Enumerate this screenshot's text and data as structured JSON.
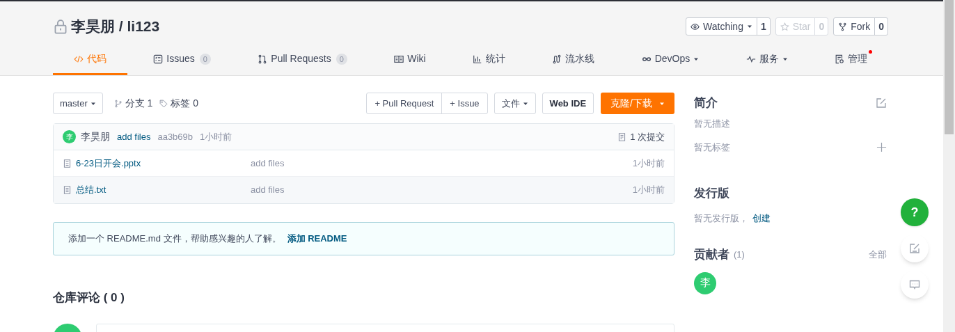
{
  "repo": {
    "title": "李昊朋 / li123",
    "private": true
  },
  "actions": [
    {
      "kind": "watch",
      "label": "Watching",
      "dropdown": true,
      "count": "1",
      "disabled": false
    },
    {
      "kind": "star",
      "label": "Star",
      "dropdown": false,
      "count": "0",
      "disabled": true
    },
    {
      "kind": "fork",
      "label": "Fork",
      "dropdown": false,
      "count": "0",
      "disabled": false
    }
  ],
  "tabs": [
    {
      "kind": "code",
      "label": "代码",
      "selected": true
    },
    {
      "kind": "issues",
      "label": "Issues",
      "count": "0",
      "selected": false
    },
    {
      "kind": "pr",
      "label": "Pull Requests",
      "count": "0",
      "selected": false
    },
    {
      "kind": "wiki",
      "label": "Wiki",
      "selected": false
    },
    {
      "kind": "stats",
      "label": "统计",
      "selected": false
    },
    {
      "kind": "pipeline",
      "label": "流水线",
      "selected": false
    },
    {
      "kind": "devops",
      "label": "DevOps",
      "dropdown": true,
      "selected": false
    },
    {
      "kind": "service",
      "label": "服务",
      "dropdown": true,
      "selected": false
    },
    {
      "kind": "manage",
      "label": "管理",
      "notification": true,
      "selected": false
    }
  ],
  "toolbar": {
    "branch": "master",
    "branches": "分支 1",
    "tags": "标签 0",
    "buttons": [
      {
        "kind": "group",
        "label": "+ Pull Request"
      },
      {
        "kind": "group",
        "label": "+ Issue"
      },
      {
        "kind": "dropdown",
        "label": "文件"
      },
      {
        "kind": "plain",
        "label": "Web IDE"
      },
      {
        "kind": "primary",
        "label": "克隆/下载"
      }
    ]
  },
  "commit": {
    "avatar": "李",
    "author": "李昊朋",
    "message": "add files",
    "hash": "aa3b69b",
    "time": "1小时前",
    "commits": "1 次提交"
  },
  "files": [
    {
      "name": "6-23日开会.pptx",
      "message": "add files",
      "time": "1小时前"
    },
    {
      "name": "总结.txt",
      "message": "add files",
      "time": "1小时前"
    }
  ],
  "readme_notice": {
    "text": "添加一个 README.md 文件，帮助感兴趣的人了解。",
    "link": "添加 README"
  },
  "comments": {
    "title": "仓库评论 ( 0 )"
  },
  "sidebar": {
    "intro_title": "简介",
    "description": "暂无描述",
    "tags": "暂无标签",
    "release_title": "发行版",
    "no_release": "暂无发行版，",
    "create_link": "创建",
    "contributors_title": "贡献者",
    "contributors_count": "(1)",
    "all_link": "全部",
    "contributors": [
      {
        "avatar": "李"
      }
    ]
  },
  "float_buttons": [
    {
      "kind": "help",
      "label": "?"
    },
    {
      "kind": "edit"
    },
    {
      "kind": "chat"
    }
  ]
}
